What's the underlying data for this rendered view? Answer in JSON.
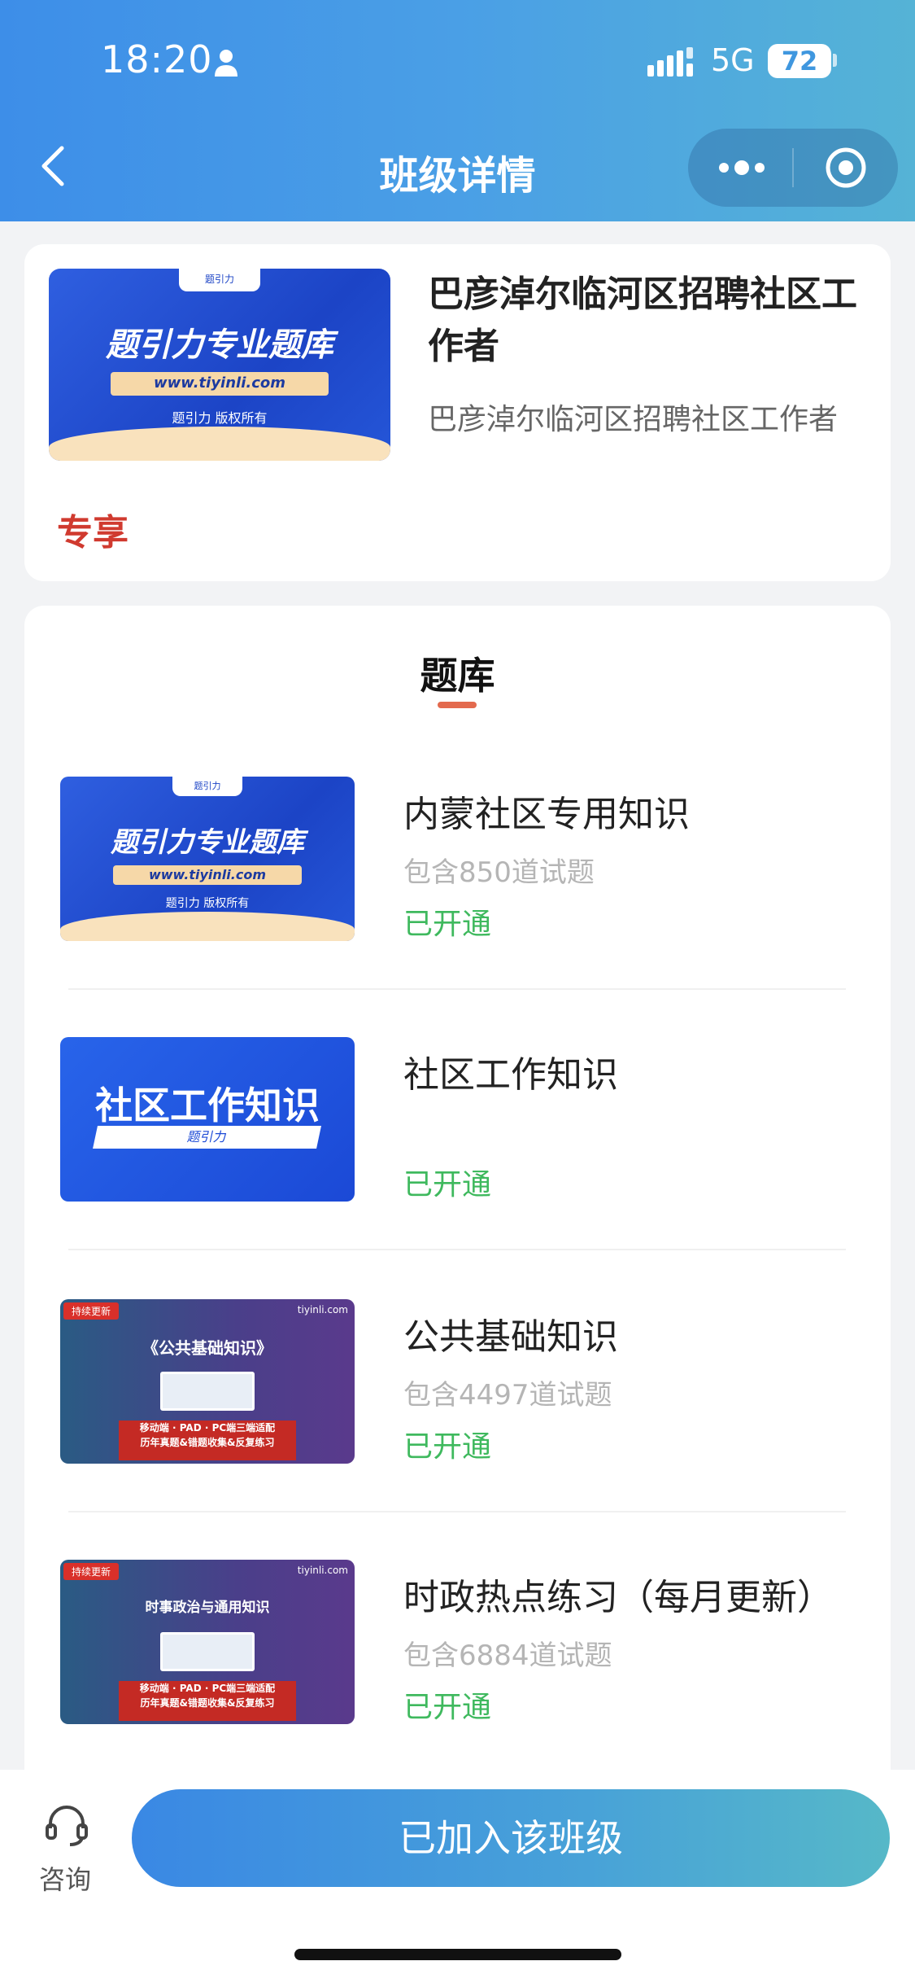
{
  "status_bar": {
    "time": "18:20",
    "network": "5G",
    "battery": "72"
  },
  "nav": {
    "title": "班级详情"
  },
  "class_info": {
    "title": "巴彦淖尔临河区招聘社区工作者",
    "subtitle": "巴彦淖尔临河区招聘社区工作者",
    "badge": "专享",
    "thumb": {
      "headline": "题引力专业题库",
      "url": "www.tiyinli.com",
      "copyright": "题引力 版权所有",
      "tab_label": "题引力"
    }
  },
  "question_bank": {
    "heading": "题库",
    "items": [
      {
        "name": "内蒙社区专用知识",
        "count": "包含850道试题",
        "status": "已开通",
        "thumb": {
          "headline": "题引力专业题库",
          "url": "www.tiyinli.com",
          "copyright": "题引力 版权所有",
          "tab_label": "题引力"
        }
      },
      {
        "name": "社区工作知识",
        "count": "",
        "status": "已开通",
        "thumb": {
          "headline": "社区工作知识",
          "bar": "题引力"
        }
      },
      {
        "name": "公共基础知识",
        "count": "包含4497道试题",
        "status": "已开通",
        "thumb": {
          "tag": "持续更新",
          "brand": "tiyinli.com",
          "heading": "《公共基础知识》",
          "banner1": "移动端 · PAD · PC端三端适配",
          "banner2": "历年真题&错题收集&反复练习"
        }
      },
      {
        "name": "时政热点练习（每月更新）",
        "count": "包含6884道试题",
        "status": "已开通",
        "thumb": {
          "tag": "持续更新",
          "brand": "tiyinli.com",
          "heading": "时事政治与通用知识",
          "banner1": "移动端 · PAD · PC端三端适配",
          "banner2": "历年真题&错题收集&反复练习"
        }
      }
    ]
  },
  "bottom_bar": {
    "consult_label": "咨询",
    "joined_label": "已加入该班级"
  },
  "colors": {
    "accent_blue": "#3d8ee8",
    "exclusive_red": "#d03a2f",
    "status_green": "#3fb95e",
    "heading_underline": "#e36a4e"
  }
}
